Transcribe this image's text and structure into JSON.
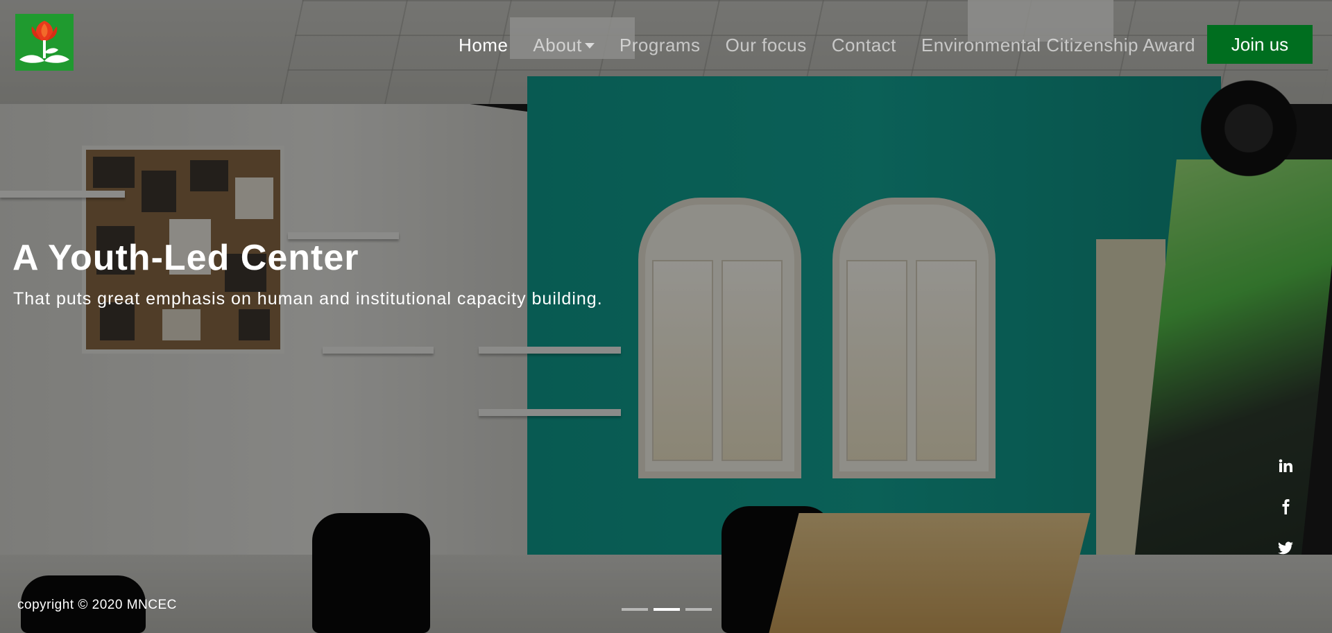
{
  "brand": {
    "logo_icon": "flower-in-hands-logo",
    "colors": {
      "primary_green": "#006e1f",
      "logo_red": "#e8391c",
      "logo_green": "#1f9a2f"
    }
  },
  "nav": {
    "items": [
      {
        "label": "Home",
        "active": true
      },
      {
        "label": "About",
        "has_dropdown": true
      },
      {
        "label": "Programs"
      },
      {
        "label": "Our focus"
      },
      {
        "label": "Contact"
      },
      {
        "label": "Environmental Citizenship Award"
      }
    ],
    "cta_label": "Join us"
  },
  "hero": {
    "title": "A Youth-Led Center",
    "subtitle": "That puts great emphasis on human and institutional capacity building."
  },
  "social": [
    {
      "icon": "linkedin-icon"
    },
    {
      "icon": "facebook-icon"
    },
    {
      "icon": "twitter-icon"
    }
  ],
  "footer": {
    "copyright": "copyright © 2020 MNCEC"
  },
  "carousel": {
    "slide_count": 3,
    "active_index": 1
  }
}
